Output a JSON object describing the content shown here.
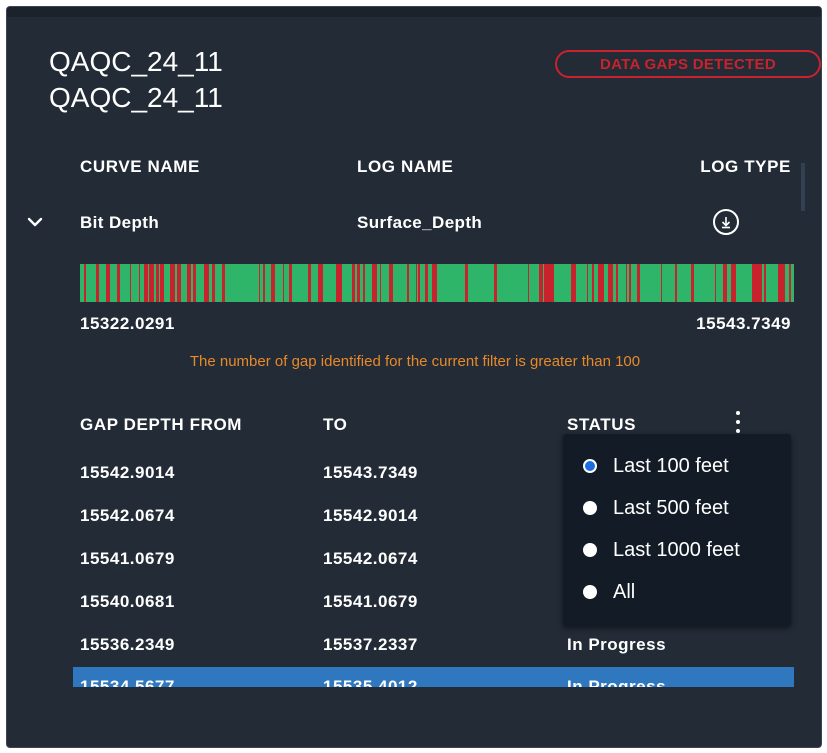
{
  "panel": {
    "title_line1": "QAQC_24_11",
    "title_line2": "QAQC_24_11",
    "badge": "DATA GAPS DETECTED"
  },
  "curve_table": {
    "headers": [
      "CURVE NAME",
      "LOG NAME",
      "LOG TYPE"
    ],
    "row": {
      "curve_name": "Bit Depth",
      "log_name": "Surface_Depth",
      "log_type_icon": "download-circle-icon"
    }
  },
  "gap_bar": {
    "range_start": "15322.0291",
    "range_end": "15543.7349",
    "colors": {
      "gap": "#c8232c",
      "data": "#2fb56a"
    }
  },
  "warning": "The number of gap identified for the current filter is greater than 100",
  "gaps_table": {
    "headers": [
      "GAP DEPTH FROM",
      "TO",
      "STATUS"
    ],
    "rows": [
      {
        "from": "15542.9014",
        "to": "15543.7349",
        "status": ""
      },
      {
        "from": "15542.0674",
        "to": "15542.9014",
        "status": ""
      },
      {
        "from": "15541.0679",
        "to": "15542.0674",
        "status": ""
      },
      {
        "from": "15540.0681",
        "to": "15541.0679",
        "status": ""
      },
      {
        "from": "15536.2349",
        "to": "15537.2337",
        "status": "In Progress"
      },
      {
        "from": "15534.5677",
        "to": "15535.4012",
        "status": "In Progress"
      }
    ]
  },
  "filter_menu": {
    "options": [
      "Last 100 feet",
      "Last 500 feet",
      "Last 1000 feet",
      "All"
    ],
    "selected": "Last 100 feet"
  }
}
